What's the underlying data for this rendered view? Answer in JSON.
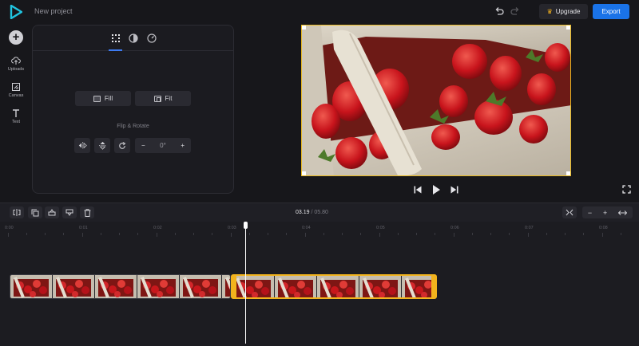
{
  "header": {
    "project_title": "New project",
    "upgrade_label": "Upgrade",
    "export_label": "Export",
    "brand_color": "#1a73e8",
    "accent_color": "#f2b31d"
  },
  "sidebar": {
    "items": [
      {
        "label": "Uploads",
        "icon": "cloud-upload-icon"
      },
      {
        "label": "Canvas",
        "icon": "canvas-icon"
      },
      {
        "label": "Text",
        "icon": "text-icon"
      }
    ]
  },
  "panel": {
    "tabs": [
      "grid-icon",
      "contrast-icon",
      "speed-icon"
    ],
    "fill_label": "Fill",
    "fit_label": "Fit",
    "flip_rotate_label": "Flip & Rotate",
    "rotation_value": "0°",
    "minus": "−",
    "plus": "+"
  },
  "timeline": {
    "current_time": "03.19",
    "separator": "/",
    "total_time": "05.80",
    "zoom_minus": "−",
    "zoom_plus": "+",
    "ticks": [
      "0:00",
      "0:01",
      "0:02",
      "0:03",
      "0:04",
      "0:05",
      "0:06",
      "0:07",
      "0:08"
    ]
  }
}
